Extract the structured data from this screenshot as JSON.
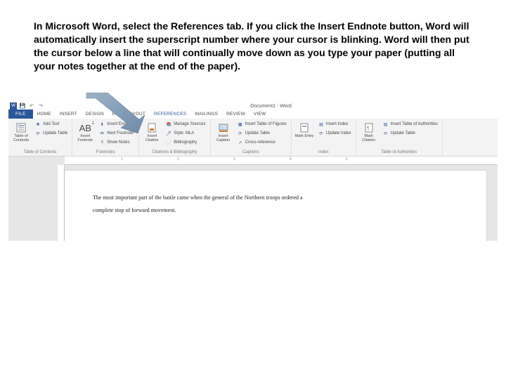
{
  "instruction": "In Microsoft Word, select the References tab. If you click the Insert Endnote button, Word will automatically insert the superscript number where your cursor is blinking. Word will then put the cursor below a line that will continually move down as you type your paper (putting all your notes together at the end of the paper).",
  "titlebar": {
    "doctitle": "Document1 - Word"
  },
  "tabs": {
    "file": "FILE",
    "home": "HOME",
    "insert": "INSERT",
    "design": "DESIGN",
    "pagelayout": "PAGE LAYOUT",
    "references": "REFERENCES",
    "mailings": "MAILINGS",
    "review": "REVIEW",
    "view": "VIEW"
  },
  "ribbon": {
    "toc": {
      "big": "Table of Contents",
      "add_text": "Add Text",
      "update": "Update Table",
      "label": "Table of Contents"
    },
    "footnotes": {
      "big": "Insert Footnote",
      "endnote": "Insert Endnote",
      "next": "Next Footnote",
      "show": "Show Notes",
      "label": "Footnotes"
    },
    "citations": {
      "big": "Insert Citation",
      "manage": "Manage Sources",
      "style": "Style: MLA",
      "bib": "Bibliography",
      "label": "Citations & Bibliography"
    },
    "captions": {
      "big": "Insert Caption",
      "tof": "Insert Table of Figures",
      "update": "Update Table",
      "cross": "Cross-reference",
      "label": "Captions"
    },
    "index": {
      "big": "Mark Entry",
      "insert": "Insert Index",
      "update": "Update Index",
      "label": "Index"
    },
    "authorities": {
      "big": "Mark Citation",
      "insert": "Insert Table of Authorities",
      "update": "Update Table",
      "label": "Table of Authorities"
    }
  },
  "document": {
    "line1": "The most important part of the battle came when the general of the Northern troops ordered a",
    "line2": "complete stop of forward movement."
  },
  "ruler": {
    "t1": "1",
    "t2": "2",
    "t3": "3",
    "t4": "4",
    "t5": "5"
  }
}
